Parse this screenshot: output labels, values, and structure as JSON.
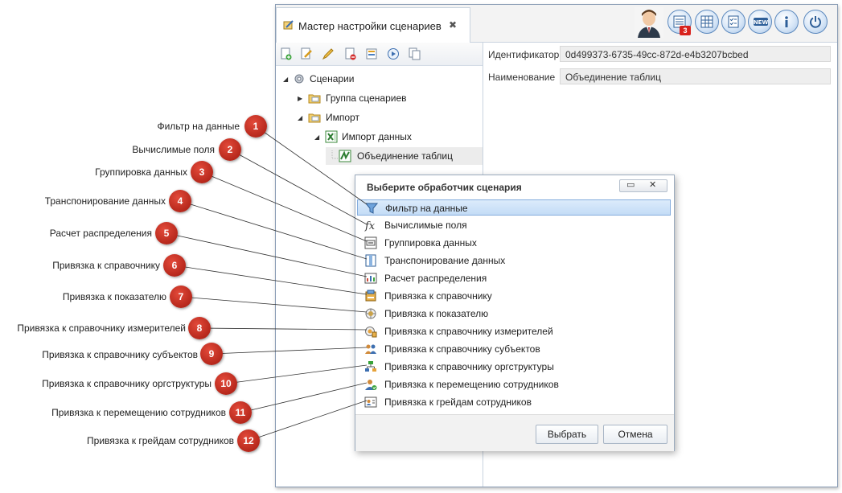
{
  "window": {
    "tab_title": "Мастер настройки сценариев",
    "tab_close_glyph": "✖",
    "header_icons": [
      "user-avatar-icon",
      "tasks-icon",
      "grid-icon",
      "checklist-icon",
      "new-icon",
      "info-icon",
      "power-icon"
    ],
    "notification_count": "3"
  },
  "tree": {
    "root": "Сценарии",
    "group": "Группа сценариев",
    "import": "Импорт",
    "import_data": "Импорт данных",
    "merge": "Объединение таблиц"
  },
  "properties": {
    "id_label": "Идентификатор",
    "id_value": "0d499373-6735-49cc-872d-e4b3207bcbed",
    "name_label": "Наименование",
    "name_value": "Объединение таблиц"
  },
  "dialog": {
    "title": "Выберите обработчик сценария",
    "items": [
      "Фильтр на данные",
      "Вычислимые поля",
      "Группировка данных",
      "Транспонирование данных",
      "Расчет распределения",
      "Привязка к справочнику",
      "Привязка к показателю",
      "Привязка к справочнику измерителей",
      "Привязка к справочнику субъектов",
      "Привязка к справочнику оргструктуры",
      "Привязка к перемещению сотрудников",
      "Привязка к грейдам сотрудников"
    ],
    "select_label": "Выбрать",
    "cancel_label": "Отмена"
  },
  "callouts": [
    {
      "num": "1",
      "text": "Фильтр на данные"
    },
    {
      "num": "2",
      "text": "Вычислимые поля"
    },
    {
      "num": "3",
      "text": "Группировка данных"
    },
    {
      "num": "4",
      "text": "Транспонирование данных"
    },
    {
      "num": "5",
      "text": "Расчет распределения"
    },
    {
      "num": "6",
      "text": "Привязка к справочнику"
    },
    {
      "num": "7",
      "text": "Привязка к показателю"
    },
    {
      "num": "8",
      "text": "Привязка к справочнику измерителей"
    },
    {
      "num": "9",
      "text": "Привязка к справочнику субъектов"
    },
    {
      "num": "10",
      "text": "Привязка к справочнику оргструктуры"
    },
    {
      "num": "11",
      "text": "Привязка к перемещению сотрудников"
    },
    {
      "num": "12",
      "text": "Привязка к грейдам сотрудников"
    }
  ],
  "colors": {
    "badge_red": "#b8231a",
    "selection_blue": "#c3dcf6",
    "accent_blue": "#5c89be"
  }
}
